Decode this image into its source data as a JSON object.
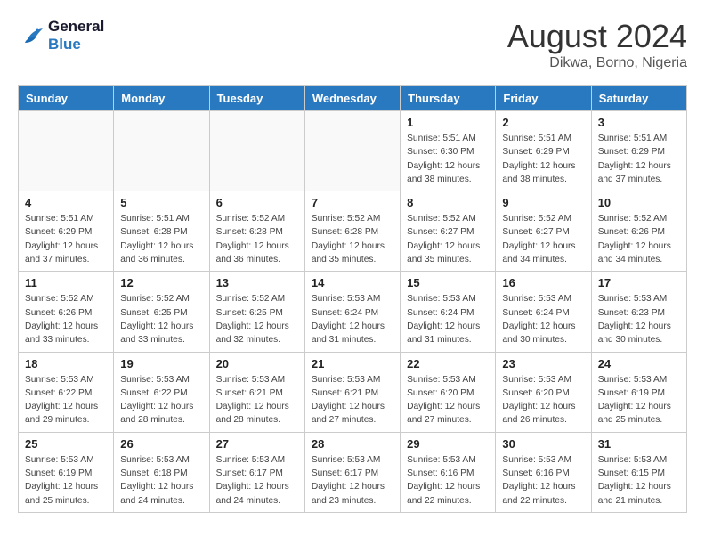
{
  "header": {
    "logo_line1": "General",
    "logo_line2": "Blue",
    "month": "August 2024",
    "location": "Dikwa, Borno, Nigeria"
  },
  "days_of_week": [
    "Sunday",
    "Monday",
    "Tuesday",
    "Wednesday",
    "Thursday",
    "Friday",
    "Saturday"
  ],
  "weeks": [
    [
      {
        "day": "",
        "info": ""
      },
      {
        "day": "",
        "info": ""
      },
      {
        "day": "",
        "info": ""
      },
      {
        "day": "",
        "info": ""
      },
      {
        "day": "1",
        "info": "Sunrise: 5:51 AM\nSunset: 6:30 PM\nDaylight: 12 hours\nand 38 minutes."
      },
      {
        "day": "2",
        "info": "Sunrise: 5:51 AM\nSunset: 6:29 PM\nDaylight: 12 hours\nand 38 minutes."
      },
      {
        "day": "3",
        "info": "Sunrise: 5:51 AM\nSunset: 6:29 PM\nDaylight: 12 hours\nand 37 minutes."
      }
    ],
    [
      {
        "day": "4",
        "info": "Sunrise: 5:51 AM\nSunset: 6:29 PM\nDaylight: 12 hours\nand 37 minutes."
      },
      {
        "day": "5",
        "info": "Sunrise: 5:51 AM\nSunset: 6:28 PM\nDaylight: 12 hours\nand 36 minutes."
      },
      {
        "day": "6",
        "info": "Sunrise: 5:52 AM\nSunset: 6:28 PM\nDaylight: 12 hours\nand 36 minutes."
      },
      {
        "day": "7",
        "info": "Sunrise: 5:52 AM\nSunset: 6:28 PM\nDaylight: 12 hours\nand 35 minutes."
      },
      {
        "day": "8",
        "info": "Sunrise: 5:52 AM\nSunset: 6:27 PM\nDaylight: 12 hours\nand 35 minutes."
      },
      {
        "day": "9",
        "info": "Sunrise: 5:52 AM\nSunset: 6:27 PM\nDaylight: 12 hours\nand 34 minutes."
      },
      {
        "day": "10",
        "info": "Sunrise: 5:52 AM\nSunset: 6:26 PM\nDaylight: 12 hours\nand 34 minutes."
      }
    ],
    [
      {
        "day": "11",
        "info": "Sunrise: 5:52 AM\nSunset: 6:26 PM\nDaylight: 12 hours\nand 33 minutes."
      },
      {
        "day": "12",
        "info": "Sunrise: 5:52 AM\nSunset: 6:25 PM\nDaylight: 12 hours\nand 33 minutes."
      },
      {
        "day": "13",
        "info": "Sunrise: 5:52 AM\nSunset: 6:25 PM\nDaylight: 12 hours\nand 32 minutes."
      },
      {
        "day": "14",
        "info": "Sunrise: 5:53 AM\nSunset: 6:24 PM\nDaylight: 12 hours\nand 31 minutes."
      },
      {
        "day": "15",
        "info": "Sunrise: 5:53 AM\nSunset: 6:24 PM\nDaylight: 12 hours\nand 31 minutes."
      },
      {
        "day": "16",
        "info": "Sunrise: 5:53 AM\nSunset: 6:24 PM\nDaylight: 12 hours\nand 30 minutes."
      },
      {
        "day": "17",
        "info": "Sunrise: 5:53 AM\nSunset: 6:23 PM\nDaylight: 12 hours\nand 30 minutes."
      }
    ],
    [
      {
        "day": "18",
        "info": "Sunrise: 5:53 AM\nSunset: 6:22 PM\nDaylight: 12 hours\nand 29 minutes."
      },
      {
        "day": "19",
        "info": "Sunrise: 5:53 AM\nSunset: 6:22 PM\nDaylight: 12 hours\nand 28 minutes."
      },
      {
        "day": "20",
        "info": "Sunrise: 5:53 AM\nSunset: 6:21 PM\nDaylight: 12 hours\nand 28 minutes."
      },
      {
        "day": "21",
        "info": "Sunrise: 5:53 AM\nSunset: 6:21 PM\nDaylight: 12 hours\nand 27 minutes."
      },
      {
        "day": "22",
        "info": "Sunrise: 5:53 AM\nSunset: 6:20 PM\nDaylight: 12 hours\nand 27 minutes."
      },
      {
        "day": "23",
        "info": "Sunrise: 5:53 AM\nSunset: 6:20 PM\nDaylight: 12 hours\nand 26 minutes."
      },
      {
        "day": "24",
        "info": "Sunrise: 5:53 AM\nSunset: 6:19 PM\nDaylight: 12 hours\nand 25 minutes."
      }
    ],
    [
      {
        "day": "25",
        "info": "Sunrise: 5:53 AM\nSunset: 6:19 PM\nDaylight: 12 hours\nand 25 minutes."
      },
      {
        "day": "26",
        "info": "Sunrise: 5:53 AM\nSunset: 6:18 PM\nDaylight: 12 hours\nand 24 minutes."
      },
      {
        "day": "27",
        "info": "Sunrise: 5:53 AM\nSunset: 6:17 PM\nDaylight: 12 hours\nand 24 minutes."
      },
      {
        "day": "28",
        "info": "Sunrise: 5:53 AM\nSunset: 6:17 PM\nDaylight: 12 hours\nand 23 minutes."
      },
      {
        "day": "29",
        "info": "Sunrise: 5:53 AM\nSunset: 6:16 PM\nDaylight: 12 hours\nand 22 minutes."
      },
      {
        "day": "30",
        "info": "Sunrise: 5:53 AM\nSunset: 6:16 PM\nDaylight: 12 hours\nand 22 minutes."
      },
      {
        "day": "31",
        "info": "Sunrise: 5:53 AM\nSunset: 6:15 PM\nDaylight: 12 hours\nand 21 minutes."
      }
    ]
  ]
}
